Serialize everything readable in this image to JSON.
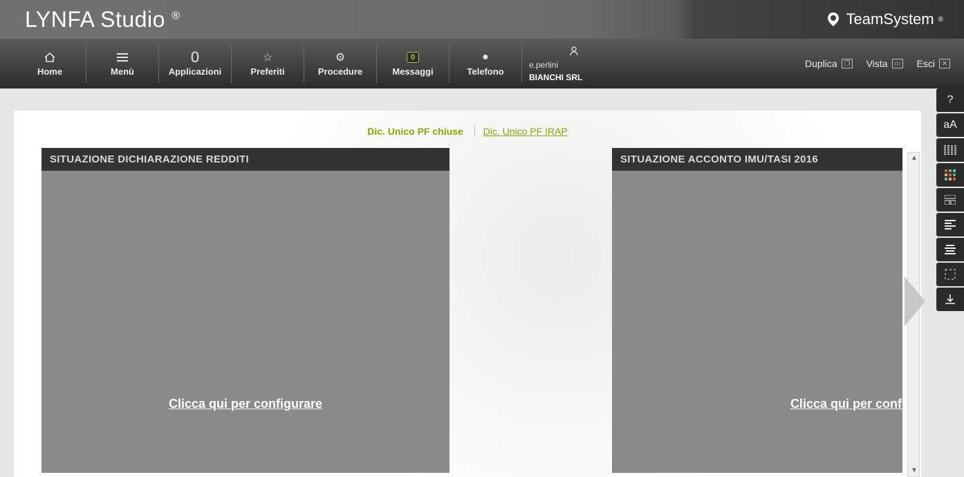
{
  "app": {
    "title": "LYNFA Studio",
    "registered": "®"
  },
  "brand": {
    "name": "TeamSystem",
    "registered": "®"
  },
  "toolbar": {
    "home": "Home",
    "menu": "Menù",
    "apps_count": "0",
    "apps": "Applicazioni",
    "favorites": "Preferiti",
    "procedures": "Procedure",
    "messages_count": "0",
    "messages": "Messaggi",
    "phone": "Telefono",
    "user_line1": "e.perlini",
    "user_line2": "BIANCHI SRL"
  },
  "toolbar_right": {
    "duplicate": "Duplica",
    "view": "Vista",
    "exit": "Esci"
  },
  "breadcrumb": {
    "active": "Dic. Unico PF chiuse",
    "link": "Dic. Unico PF IRAP"
  },
  "panels": {
    "left_title": "SITUAZIONE DICHIARAZIONE REDDITI",
    "right_title": "SITUAZIONE ACCONTO IMU/TASI 2016",
    "configure": "Clicca qui per configurare"
  },
  "side_tools": {
    "help": "?",
    "font": "aA",
    "spacing": "≣",
    "apps": "▦",
    "layout": "⧉",
    "align": "≡",
    "text": "≡",
    "fullscreen": "⛶",
    "download": "⭳"
  }
}
